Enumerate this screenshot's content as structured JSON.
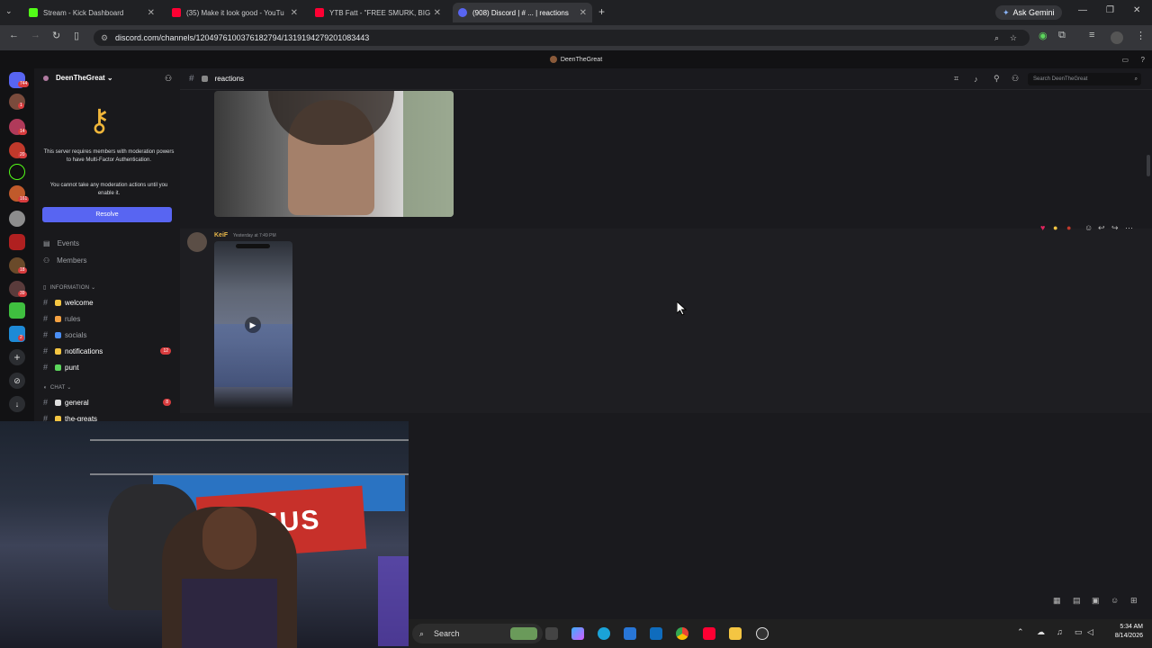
{
  "browser": {
    "tabs": [
      {
        "title": "Stream - Kick Dashboard",
        "color": "#53fc18"
      },
      {
        "title": "(35) Make it look good - YouTu",
        "color": "#ff0033"
      },
      {
        "title": "YTB Fatt - \"FREE SMURK, BIG E",
        "color": "#ff0033"
      },
      {
        "title": "(908) Discord | # ... | reactions",
        "color": "#5865f2"
      }
    ],
    "ask_gemini": "Ask Gemini",
    "url": "discord.com/channels/1204976100376182794/1319194279201083443"
  },
  "discord": {
    "window_title": "DeenTheGreat",
    "server_name": "DeenTheGreat",
    "mfa_text_1": "This server requires members with moderation powers to have Multi-Factor Authentication.",
    "mfa_text_2": "You cannot take any moderation actions until you enable it.",
    "resolve_label": "Resolve",
    "events_label": "Events",
    "members_label": "Members",
    "category_information": "INFORMATION",
    "category_chat": "CHAT",
    "channels": [
      {
        "name": "welcome",
        "emoji_color": "#f4c542",
        "bold": true
      },
      {
        "name": "rules",
        "emoji_color": "#f4a142",
        "bold": false
      },
      {
        "name": "socials",
        "emoji_color": "#4a8ef4",
        "bold": false
      },
      {
        "name": "notifications",
        "emoji_color": "#f4c542",
        "bold": true,
        "count": "12"
      },
      {
        "name": "punt",
        "emoji_color": "#5cd65c",
        "bold": true
      }
    ],
    "chat_channels": [
      {
        "name": "general",
        "count": "8"
      },
      {
        "name": "the-greats"
      }
    ],
    "guild_badges": [
      "744",
      "1",
      "14",
      "20",
      "161",
      "18",
      "39",
      "2"
    ],
    "current_channel": "reactions",
    "search_placeholder": "Search DeenTheGreat",
    "message": {
      "author": "KeiF",
      "timestamp": "Yesterday at 7:49 PM"
    }
  },
  "taskbar": {
    "search_label": "Search",
    "time": "5:34 AM",
    "date": "8/14/2026"
  }
}
